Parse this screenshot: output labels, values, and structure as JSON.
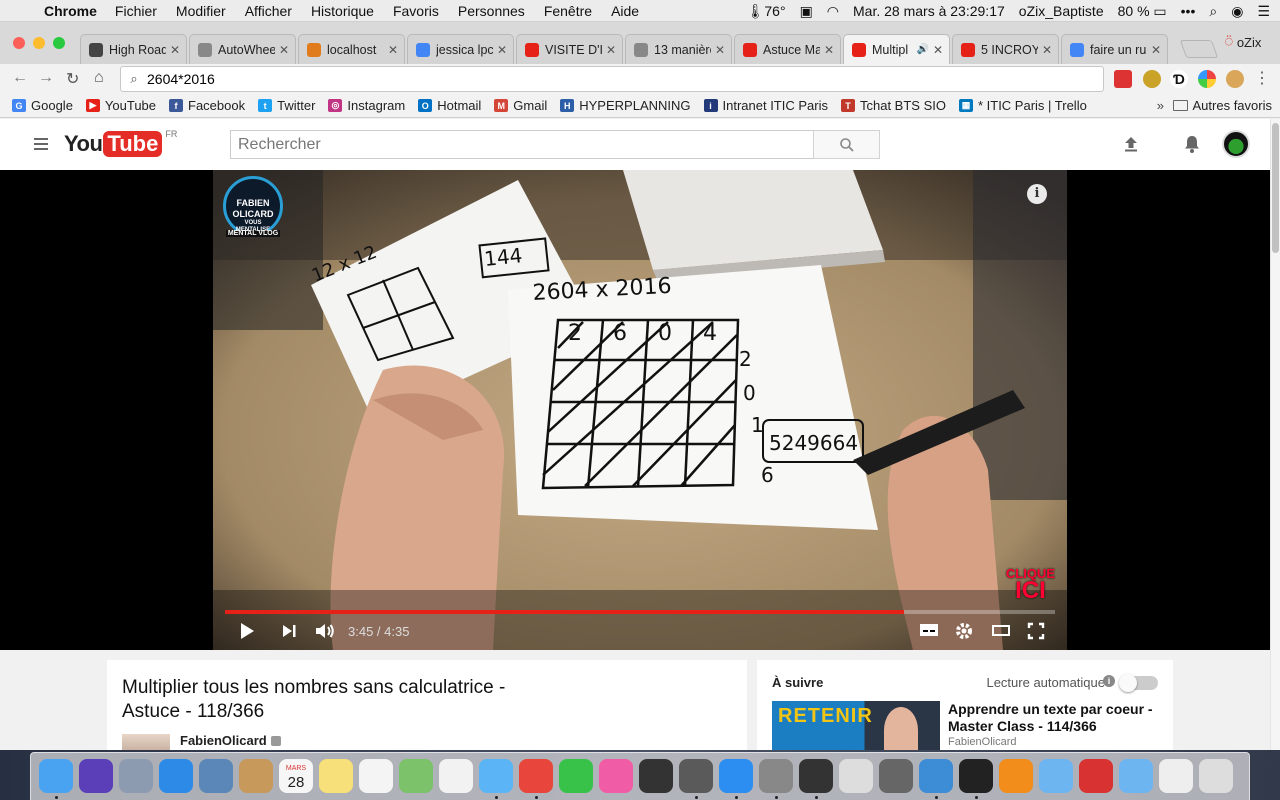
{
  "menubar": {
    "app_name": "Chrome",
    "menus": [
      "Fichier",
      "Modifier",
      "Afficher",
      "Historique",
      "Favoris",
      "Personnes",
      "Fenêtre",
      "Aide"
    ],
    "weather": "76°",
    "datetime": "Mar. 28 mars à  23:29:17",
    "user": "oZix_Baptiste",
    "battery": "80 %"
  },
  "tabs": [
    {
      "title": "High Road",
      "icon": "github-icon",
      "color": "#444"
    },
    {
      "title": "AutoWheel",
      "icon": "page-icon",
      "color": "#888"
    },
    {
      "title": "localhost",
      "icon": "phpmyadmin-icon",
      "color": "#e07c1b"
    },
    {
      "title": "jessica lpc",
      "icon": "google-icon",
      "color": "#4285f4"
    },
    {
      "title": "VISITE D'I",
      "icon": "youtube-icon",
      "color": "#e62117"
    },
    {
      "title": "13 manière",
      "icon": "page-icon",
      "color": "#888"
    },
    {
      "title": "Astuce Ma",
      "icon": "youtube-icon",
      "color": "#e62117"
    },
    {
      "title": "Multipl",
      "icon": "youtube-icon",
      "color": "#e62117",
      "active": true
    },
    {
      "title": "5 INCROY",
      "icon": "youtube-icon",
      "color": "#e62117"
    },
    {
      "title": "faire un ru",
      "icon": "google-icon",
      "color": "#4285f4"
    }
  ],
  "profile_name": "oZix",
  "omnibox": {
    "value": "2604*2016"
  },
  "bookmarks": [
    {
      "label": "Google",
      "icon": "google-icon",
      "color": "#4285f4",
      "glyph": "G"
    },
    {
      "label": "YouTube",
      "icon": "youtube-icon",
      "color": "#e62117",
      "glyph": "▶"
    },
    {
      "label": "Facebook",
      "icon": "facebook-icon",
      "color": "#3b5998",
      "glyph": "f"
    },
    {
      "label": "Twitter",
      "icon": "twitter-icon",
      "color": "#1da1f2",
      "glyph": "t"
    },
    {
      "label": "Instagram",
      "icon": "instagram-icon",
      "color": "#c13584",
      "glyph": "◎"
    },
    {
      "label": "Hotmail",
      "icon": "outlook-icon",
      "color": "#0072c6",
      "glyph": "O"
    },
    {
      "label": "Gmail",
      "icon": "gmail-icon",
      "color": "#d44638",
      "glyph": "M"
    },
    {
      "label": "HYPERPLANNING",
      "icon": "hyperplanning-icon",
      "color": "#2c5fa8",
      "glyph": "H"
    },
    {
      "label": "Intranet ITIC Paris",
      "icon": "itic-icon",
      "color": "#223a7a",
      "glyph": "i"
    },
    {
      "label": "Tchat BTS SIO",
      "icon": "chat-icon",
      "color": "#c0392b",
      "glyph": "T"
    },
    {
      "label": "* ITIC Paris | Trello",
      "icon": "trello-icon",
      "color": "#0079bf",
      "glyph": "▦"
    }
  ],
  "bookmarks_more": "»",
  "other_bookmarks": "Autres favoris",
  "youtube": {
    "logo_you": "You",
    "logo_tube": "Tube",
    "country": "FR",
    "search_placeholder": "Rechercher"
  },
  "player": {
    "badge_line1": "FABIEN",
    "badge_line2": "OLICARD",
    "badge_line3": "VOUS",
    "badge_line4": "MENTALISE",
    "badge_strip": "MENTAL VLOG",
    "clique_top": "CLIQUE",
    "clique_big": "ICI",
    "current_time": "3:45",
    "duration": "4:35",
    "progress_fraction": 0.818,
    "paper_small_title": "12 x 12",
    "paper_small_result": "144",
    "paper_big_title": "2604 x 2016",
    "paper_big_result": "5249664",
    "grid_top": [
      "2",
      "6",
      "0",
      "4"
    ],
    "grid_right": [
      "2",
      "0",
      "1",
      "6"
    ]
  },
  "video": {
    "title": "Multiplier tous les nombres sans calculatrice - Astuce - 118/366",
    "owner": "FabienOlicard"
  },
  "sidebar": {
    "up_next": "À suivre",
    "autoplay": "Lecture automatique",
    "next_title": "Apprendre un texte par coeur - Master Class - 114/366",
    "next_channel": "FabienOlicard",
    "next_thumb_text": "RETENIR"
  },
  "dock": {
    "apps": [
      {
        "name": "finder",
        "color": "#4aa3f0"
      },
      {
        "name": "siri",
        "color": "#5b3fb8"
      },
      {
        "name": "launchpad",
        "color": "#8c9bb0"
      },
      {
        "name": "safari",
        "color": "#2d8ae6"
      },
      {
        "name": "mail-bird",
        "color": "#5b87b8"
      },
      {
        "name": "contacts",
        "color": "#c79a5b"
      },
      {
        "name": "calendar",
        "color": "#f6f6f6"
      },
      {
        "name": "notes",
        "color": "#f7e07a"
      },
      {
        "name": "reminders",
        "color": "#f4f4f4"
      },
      {
        "name": "maps",
        "color": "#7cc26b"
      },
      {
        "name": "photos",
        "color": "#f2f2f2"
      },
      {
        "name": "messages",
        "color": "#5ab4f6"
      },
      {
        "name": "chrome",
        "color": "#e8453c"
      },
      {
        "name": "facetime",
        "color": "#39c24a"
      },
      {
        "name": "itunes",
        "color": "#f05ca6"
      },
      {
        "name": "sketch",
        "color": "#333"
      },
      {
        "name": "sublime",
        "color": "#5a5a5a"
      },
      {
        "name": "app-store",
        "color": "#2b8ef0"
      },
      {
        "name": "system-preferences",
        "color": "#888"
      },
      {
        "name": "photo-booth",
        "color": "#333"
      },
      {
        "name": "preview",
        "color": "#ddd"
      },
      {
        "name": "sequel",
        "color": "#666"
      },
      {
        "name": "wunderlist",
        "color": "#3c8cd6"
      },
      {
        "name": "terminal",
        "color": "#222"
      },
      {
        "name": "vlc",
        "color": "#f28c1a"
      },
      {
        "name": "folder",
        "color": "#6cb5f0"
      },
      {
        "name": "creative-cloud",
        "color": "#d83232"
      },
      {
        "name": "documents-folder",
        "color": "#6cb5f0"
      },
      {
        "name": "file",
        "color": "#eee"
      },
      {
        "name": "trash",
        "color": "#ddd"
      }
    ],
    "calendar_month": "MARS",
    "calendar_day": "28"
  }
}
